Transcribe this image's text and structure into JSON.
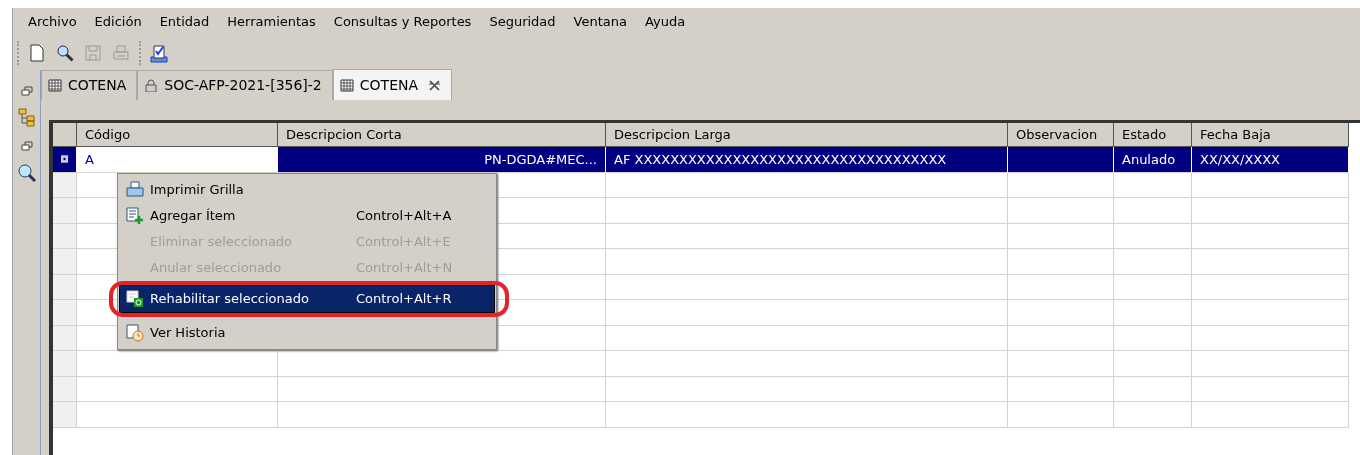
{
  "menu_bar": [
    "Archivo",
    "Edición",
    "Entidad",
    "Herramientas",
    "Consultas y Reportes",
    "Seguridad",
    "Ventana",
    "Ayuda"
  ],
  "toolbar": [
    {
      "kind": "new",
      "disabled": false
    },
    {
      "kind": "search",
      "disabled": false
    },
    {
      "kind": "save",
      "disabled": true
    },
    {
      "kind": "print",
      "disabled": true
    },
    {
      "kind": "check",
      "disabled": false
    }
  ],
  "tabs": [
    {
      "label": "COTENA",
      "kind": "table",
      "selected": false,
      "closable": false
    },
    {
      "label": "SOC-AFP-2021-[356]-2",
      "kind": "locked",
      "selected": false,
      "closable": false
    },
    {
      "label": "COTENA",
      "kind": "table",
      "selected": true,
      "closable": true
    }
  ],
  "table": {
    "columns": [
      "Código",
      "Descripcion Corta",
      "Descripcion Larga",
      "Observacion",
      "Estado",
      "Fecha Baja"
    ],
    "rows": [
      {
        "selected": true,
        "cells": [
          "A",
          "PN-DGDA#MEC...",
          "AF XXXXXXXXXXXXXXXXXXXXXXXXXXXXXXXXXXX",
          "",
          "Anulado",
          "XX/XX/XXXX"
        ]
      }
    ]
  },
  "context_menu": {
    "items": [
      {
        "label": "Imprimir Grilla",
        "kind": "print",
        "disabled": false,
        "selected": false,
        "annotated": false
      },
      {
        "label": "Agregar Ítem",
        "shortcut": "Control+Alt+A",
        "kind": "add",
        "disabled": false,
        "selected": false,
        "annotated": false
      },
      {
        "label": "Eliminar seleccionado",
        "shortcut": "Control+Alt+E",
        "kind": "plain",
        "disabled": true,
        "selected": false,
        "annotated": false
      },
      {
        "label": "Anular seleccionado",
        "shortcut": "Control+Alt+N",
        "kind": "plain",
        "disabled": true,
        "selected": false,
        "annotated": false
      },
      {
        "label": "Rehabilitar seleccionado",
        "shortcut": "Control+Alt+R",
        "kind": "restore",
        "disabled": false,
        "selected": true,
        "annotated": true
      },
      {
        "label": "Ver Historia",
        "kind": "history",
        "disabled": false,
        "selected": false,
        "annotated": false,
        "separator_before": true
      }
    ]
  }
}
